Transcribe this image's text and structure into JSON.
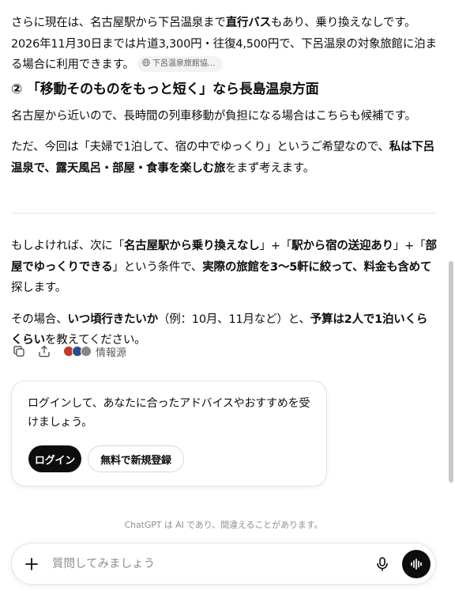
{
  "message": {
    "p1": {
      "t1": "さらに現在は、名古屋駅から下呂温泉まで",
      "b1": "直行バス",
      "t2": "もあり、乗り換えなしです。2026年11月30日までは片道3,300円・往復4,500円で、下呂温泉の対象旅館に泊まる場合に利用できます。",
      "citation": "下呂温泉旅館協..."
    },
    "heading2": "② 「移動そのものをもっと短く」なら長島温泉方面",
    "p2": "名古屋から近いので、長時間の列車移動が負担になる場合はこちらも候補です。",
    "p3": {
      "t1": "ただ、今回は「夫婦で1泊して、宿の中でゆっくり」というご希望なので、",
      "b1": "私は下呂温泉で、露天風呂・部屋・食事を楽しむ旅",
      "t2": "をまず考えます。"
    },
    "p4": {
      "t1": "もしよければ、次に「",
      "b1": "名古屋駅から乗り換えなし",
      "t2": "」+「",
      "b2": "駅から宿の送迎あり",
      "t3": "」+「",
      "b3": "部屋でゆっくりできる",
      "t4": "」という条件で、",
      "b4": "実際の旅館を3〜5軒に絞って、料金も含めて",
      "t5": "探します。"
    },
    "p5": {
      "t1": "その場合、",
      "b1": "いつ頃行きたいか",
      "t2": "（例：10月、11月など）と、",
      "b2": "予算は2人で1泊いくらくらい",
      "t3": "を教えてください。"
    }
  },
  "actions": {
    "copy_icon": "copy-icon",
    "share_icon": "share-icon",
    "sources_label": "情報源",
    "source_colors": [
      "#c0392b",
      "#2a4d8f",
      "#888888"
    ]
  },
  "login_card": {
    "text": "ログインして、あなたに合ったアドバイスやおすすめを受けましょう。",
    "login_label": "ログイン",
    "signup_label": "無料で新規登録"
  },
  "disclaimer": "ChatGPT は AI であり、間違えることがあります。",
  "composer": {
    "placeholder": "質問してみましょう"
  },
  "colors": {
    "text": "#0d0d0d",
    "muted": "#5d5d5d",
    "button_dark": "#0d0d0d"
  }
}
